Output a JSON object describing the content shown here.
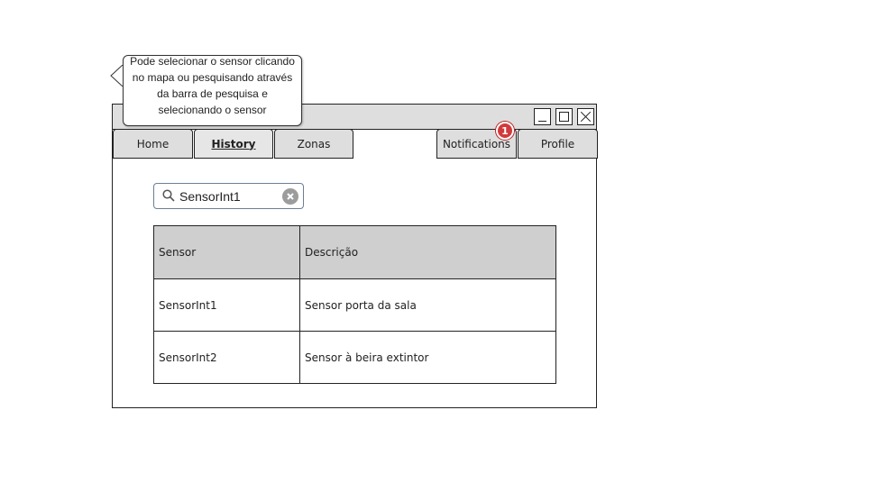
{
  "tabs": {
    "home": "Home",
    "history": "History",
    "zonas": "Zonas",
    "notifications": "Notifications",
    "profile": "Profile"
  },
  "notifications_badge": "1",
  "search": {
    "value": "SensorInt1"
  },
  "table": {
    "headers": [
      "Sensor",
      "Descrição"
    ],
    "rows": [
      [
        "SensorInt1",
        "Sensor porta da sala"
      ],
      [
        "SensorInt2",
        "Sensor à beira extintor"
      ]
    ]
  },
  "callout": {
    "text": "Pode selecionar o sensor clicando no mapa ou pesquisando através da barra de pesquisa e selecionando o sensor"
  },
  "colors": {
    "badge": "#d13b3b",
    "header_bg": "#cfcfcf",
    "titlebar_bg": "#dedede"
  }
}
